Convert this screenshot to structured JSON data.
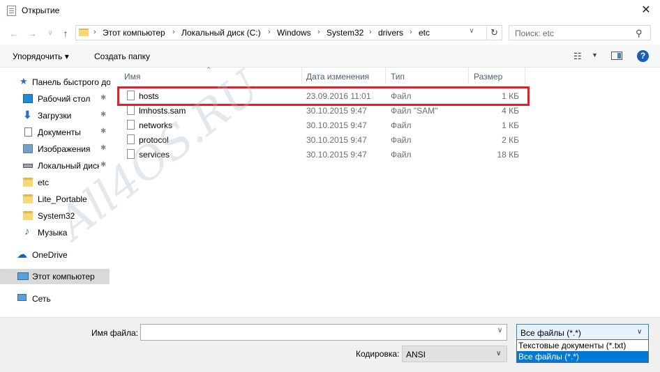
{
  "window": {
    "title": "Открытие",
    "close_glyph": "✕"
  },
  "nav": {
    "back_glyph": "←",
    "forward_glyph": "→",
    "recent_glyph": "∨",
    "up_glyph": "↑",
    "refresh_glyph": "↻"
  },
  "address": {
    "crumbs": [
      "Этот компьютер",
      "Локальный диск (C:)",
      "Windows",
      "System32",
      "drivers",
      "etc"
    ],
    "separator": "›",
    "dropdown_glyph": "∨"
  },
  "search": {
    "placeholder": "Поиск: etc",
    "icon_glyph": "⚲"
  },
  "toolbar": {
    "organize_label": "Упорядочить ▾",
    "new_folder_label": "Создать папку",
    "view_glyph": "☷",
    "view_dd_glyph": "▼",
    "help_glyph": "?"
  },
  "sidebar": {
    "pin_glyph": "✱",
    "items": [
      {
        "label": "Панель быстрого доступа",
        "icon": "star-icon"
      },
      {
        "label": "Рабочий стол",
        "icon": "desktop-icon"
      },
      {
        "label": "Загрузки",
        "icon": "download-icon"
      },
      {
        "label": "Документы",
        "icon": "documents-icon"
      },
      {
        "label": "Изображения",
        "icon": "pictures-icon"
      },
      {
        "label": "Локальный диск (C:)",
        "icon": "drive-icon"
      },
      {
        "label": "etc",
        "icon": "folder-icon"
      },
      {
        "label": "Lite_Portable",
        "icon": "folder-icon"
      },
      {
        "label": "System32",
        "icon": "folder-icon"
      },
      {
        "label": "Музыка",
        "icon": "music-icon"
      },
      {
        "label": "OneDrive",
        "icon": "cloud-icon"
      },
      {
        "label": "Этот компьютер",
        "icon": "computer-icon"
      },
      {
        "label": "Сеть",
        "icon": "network-icon"
      }
    ]
  },
  "filelist": {
    "sort_glyph": "^",
    "columns": [
      "Имя",
      "Дата изменения",
      "Тип",
      "Размер"
    ],
    "rows": [
      {
        "name": "hosts",
        "date": "23.09.2016 11:01",
        "type": "Файл",
        "size": "1 КБ"
      },
      {
        "name": "lmhosts.sam",
        "date": "30.10.2015 9:47",
        "type": "Файл \"SAM\"",
        "size": "4 КБ"
      },
      {
        "name": "networks",
        "date": "30.10.2015 9:47",
        "type": "Файл",
        "size": "1 КБ"
      },
      {
        "name": "protocol",
        "date": "30.10.2015 9:47",
        "type": "Файл",
        "size": "2 КБ"
      },
      {
        "name": "services",
        "date": "30.10.2015 9:47",
        "type": "Файл",
        "size": "18 КБ"
      }
    ],
    "highlight_color": "#e0202b"
  },
  "watermark": "All4OS.RU",
  "bottom": {
    "filename_label": "Имя файла:",
    "filename_value": "",
    "filetype_value": "Все файлы  (*.*)",
    "filetype_options": [
      "Текстовые документы (*.txt)",
      "Все файлы  (*.*)"
    ],
    "encoding_label": "Кодировка:",
    "encoding_value": "ANSI",
    "dropdown_glyph": "∨"
  },
  "colors": {
    "accent": "#0078d7",
    "help": "#1a5fb4",
    "selected_nav": "#d9d9d9",
    "header_text": "#4c607a"
  }
}
